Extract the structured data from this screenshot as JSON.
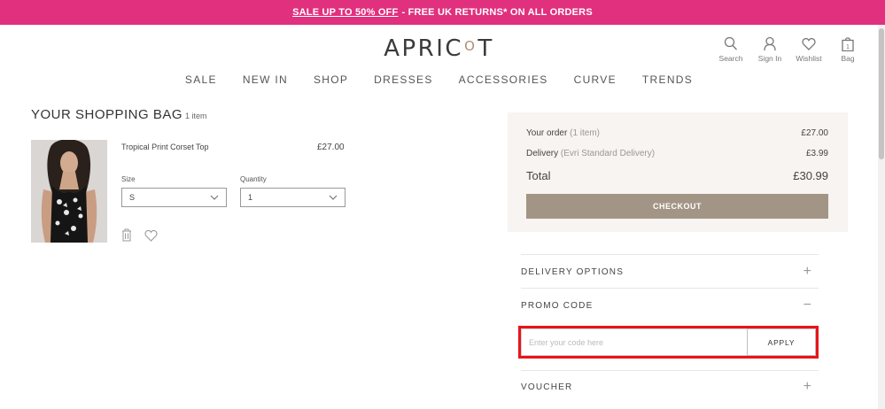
{
  "banner": {
    "sale_link": "SALE UP TO 50% OFF",
    "rest": "- FREE UK RETURNS* ON ALL ORDERS",
    "background": "#e0307e"
  },
  "logo": {
    "left": "APRIC",
    "right": "T"
  },
  "header_icons": [
    {
      "icon": "search-icon",
      "label": "Search"
    },
    {
      "icon": "user-icon",
      "label": "Sign In"
    },
    {
      "icon": "heart-icon",
      "label": "Wishlist"
    },
    {
      "icon": "bag-icon",
      "label": "Bag",
      "count": "1"
    }
  ],
  "nav": [
    "SALE",
    "NEW IN",
    "SHOP",
    "DRESSES",
    "ACCESSORIES",
    "CURVE",
    "TRENDS"
  ],
  "bag": {
    "title": "YOUR SHOPPING BAG",
    "count": "1 item",
    "item": {
      "name": "Tropical Print Corset Top",
      "price": "£27.00",
      "size_label": "Size",
      "size_value": "S",
      "quantity_label": "Quantity",
      "quantity_value": "1"
    }
  },
  "summary": {
    "order_label": "Your order",
    "order_count": "(1 item)",
    "order_value": "£27.00",
    "delivery_label": "Delivery",
    "delivery_method": "(Evri Standard Delivery)",
    "delivery_value": "£3.99",
    "total_label": "Total",
    "total_value": "£30.99",
    "checkout_label": "CHECKOUT"
  },
  "accordion": {
    "delivery_options": "DELIVERY OPTIONS",
    "delivery_sign": "+",
    "promo_code": "PROMO CODE",
    "promo_sign": "−",
    "voucher": "VOUCHER",
    "voucher_sign": "+"
  },
  "promo": {
    "placeholder": "Enter your code here",
    "value": "",
    "apply_label": "APPLY",
    "highlight_color": "#e8141b"
  },
  "colors": {
    "accent": "#e0307e",
    "checkout": "#a39585",
    "summary_bg": "#f7f4f2"
  }
}
